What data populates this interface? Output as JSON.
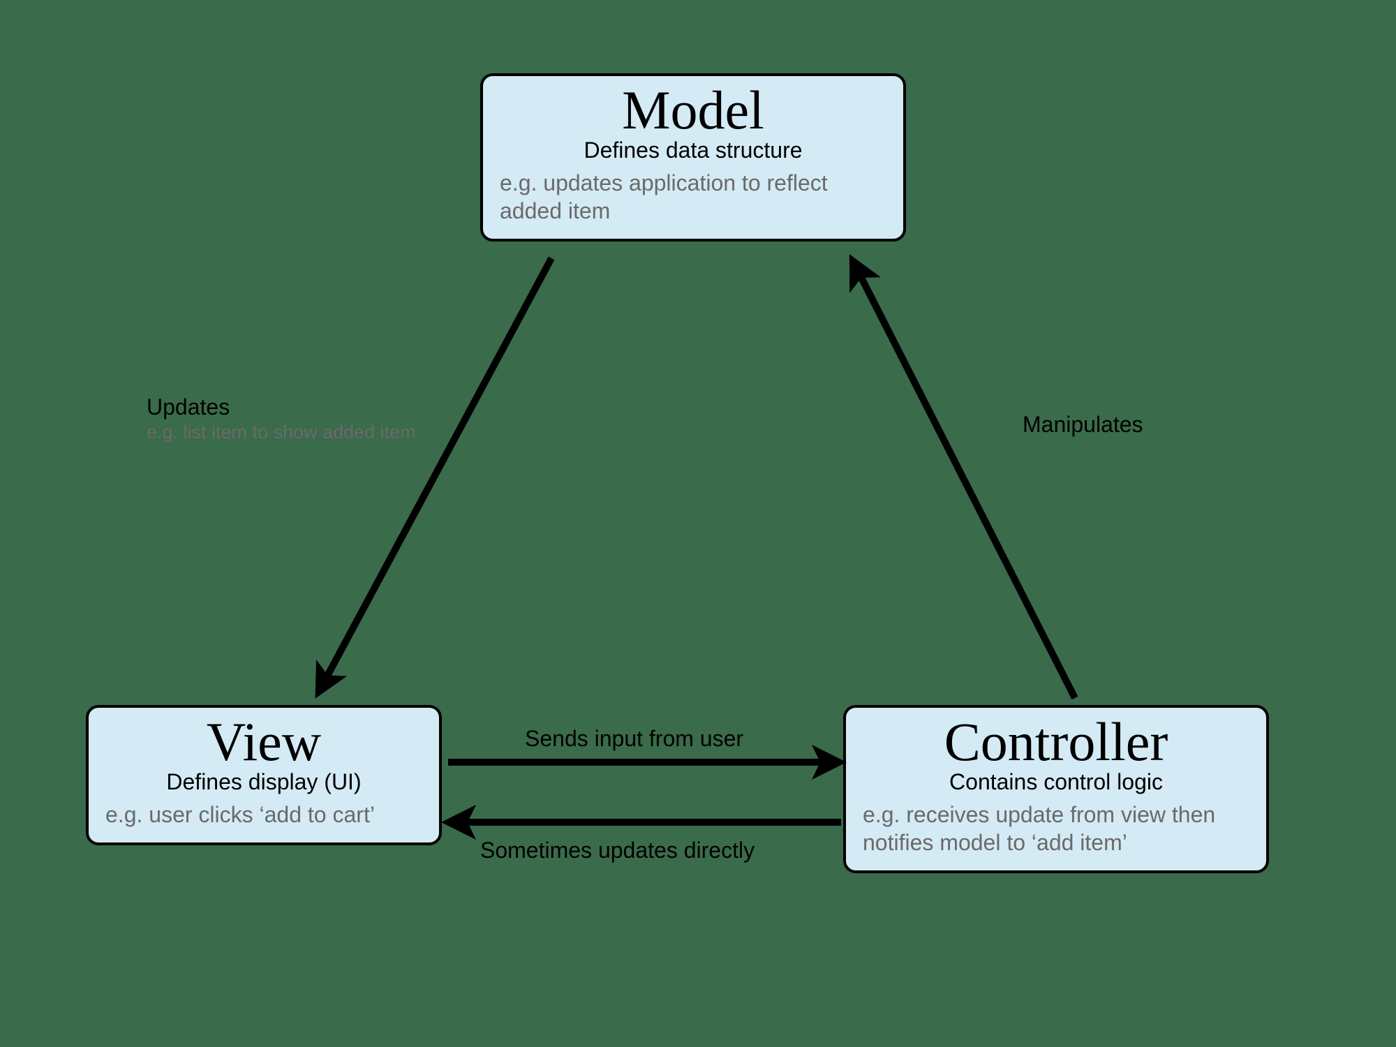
{
  "nodes": {
    "model": {
      "title": "Model",
      "subtitle": "Defines data structure",
      "example": "e.g. updates application to reflect added item"
    },
    "view": {
      "title": "View",
      "subtitle": "Defines display (UI)",
      "example": "e.g. user clicks ‘add to cart’"
    },
    "controller": {
      "title": "Controller",
      "subtitle": "Contains control logic",
      "example": "e.g. receives update from view then notifies model to ‘add item’"
    }
  },
  "edges": {
    "model_to_view": {
      "label": "Updates",
      "sublabel": "e.g. list item to show added item"
    },
    "controller_to_model": {
      "label": "Manipulates"
    },
    "view_to_controller": {
      "label": "Sends input from user"
    },
    "controller_to_view": {
      "label": "Sometimes updates directly"
    }
  }
}
